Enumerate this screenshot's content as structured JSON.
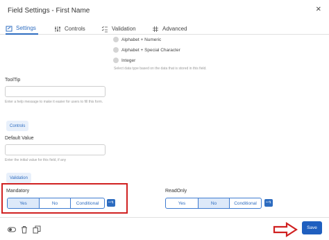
{
  "window": {
    "title": "Field Settings - First Name",
    "close_glyph": "×"
  },
  "tabs": [
    {
      "label": "Settings",
      "icon": "settings-tab-icon",
      "active": true
    },
    {
      "label": "Controls",
      "icon": "sliders-icon",
      "active": false
    },
    {
      "label": "Validation",
      "icon": "checklist-icon",
      "active": false
    },
    {
      "label": "Advanced",
      "icon": "grid-icon",
      "active": false
    }
  ],
  "data_type": {
    "options": [
      "Alphabet + Numeric",
      "Alphabet + Special Character",
      "Integer"
    ],
    "hint": "Select data type based on the data that is stored in this field."
  },
  "tooltip": {
    "label": "ToolTip",
    "value": "",
    "hint": "Enter a help message to make it easier for users to fill this form."
  },
  "controls_section": {
    "label": "Controls"
  },
  "default_value": {
    "label": "Default Value",
    "value": "",
    "hint": "Enter the initial value for this field, if any"
  },
  "validation_section": {
    "label": "Validation"
  },
  "mandatory": {
    "label": "Mandatory",
    "options": [
      "Yes",
      "No",
      "Conditional"
    ],
    "selected": "Yes",
    "icon": "conditional-rule-icon"
  },
  "readonly": {
    "label": "ReadOnly",
    "options": [
      "Yes",
      "No",
      "Conditional"
    ],
    "selected": "No",
    "icon": "conditional-rule-icon"
  },
  "footer": {
    "icons": [
      "toggle-icon",
      "trash-icon",
      "copy-icon"
    ],
    "save_label": "Save"
  },
  "colors": {
    "accent": "#2d6cc0",
    "highlight": "#d02020",
    "save": "#1f5fbf"
  }
}
